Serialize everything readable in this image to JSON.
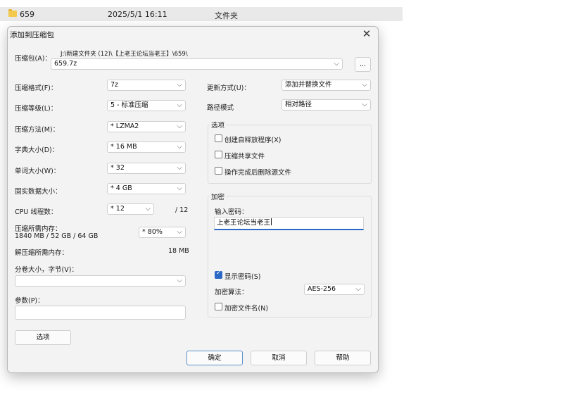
{
  "explorer_row": {
    "name": "659",
    "date": "2025/5/1 16:11",
    "type": "文件夹"
  },
  "dialog": {
    "title": "添加到压缩包",
    "close_glyph": "✕",
    "archive_label": "压缩包(A)：",
    "archive_path": "J:\\新建文件夹 (12)\\【上老王论坛当老王】\\659\\",
    "archive_name": "659.7z",
    "browse_label": "...",
    "format_label": "压缩格式(F)：",
    "format_value": "7z",
    "level_label": "压缩等级(L)：",
    "level_value": "5 - 标准压缩",
    "method_label": "压缩方法(M)：",
    "method_value": "* LZMA2",
    "dict_label": "字典大小(D)：",
    "dict_value": "* 16 MB",
    "word_label": "单词大小(W)：",
    "word_value": "* 32",
    "solid_label": "固实数据大小：",
    "solid_value": "* 4 GB",
    "threads_label": "CPU 线程数：",
    "threads_value": "* 12",
    "threads_total": "/ 12",
    "mem_label": "压缩所需内存：",
    "mem_detail": "1840 MB / 52 GB / 64 GB",
    "mem_value": "* 80%",
    "decomp_label": "解压缩所需内存：",
    "decomp_value": "18 MB",
    "volume_label": "分卷大小，字节(V)：",
    "volume_value": "",
    "params_label": "参数(P)：",
    "params_value": "",
    "options_button": "选项",
    "update_label": "更新方式(U)：",
    "update_value": "添加并替换文件",
    "pathmode_label": "路径模式",
    "pathmode_value": "相对路径",
    "options_group": "选项",
    "opt_sfx": "创建自释放程序(X)",
    "opt_shared": "压缩共享文件",
    "opt_delete": "操作完成后删除源文件",
    "encrypt_group": "加密",
    "password_label": "输入密码：",
    "password_value": "上老王论坛当老王",
    "show_password": "显示密码(S)",
    "enc_method_label": "加密算法：",
    "enc_method_value": "AES-256",
    "encrypt_names": "加密文件名(N)",
    "ok": "确定",
    "cancel": "取消",
    "help": "帮助",
    "chevron_glyph": "⌵"
  }
}
